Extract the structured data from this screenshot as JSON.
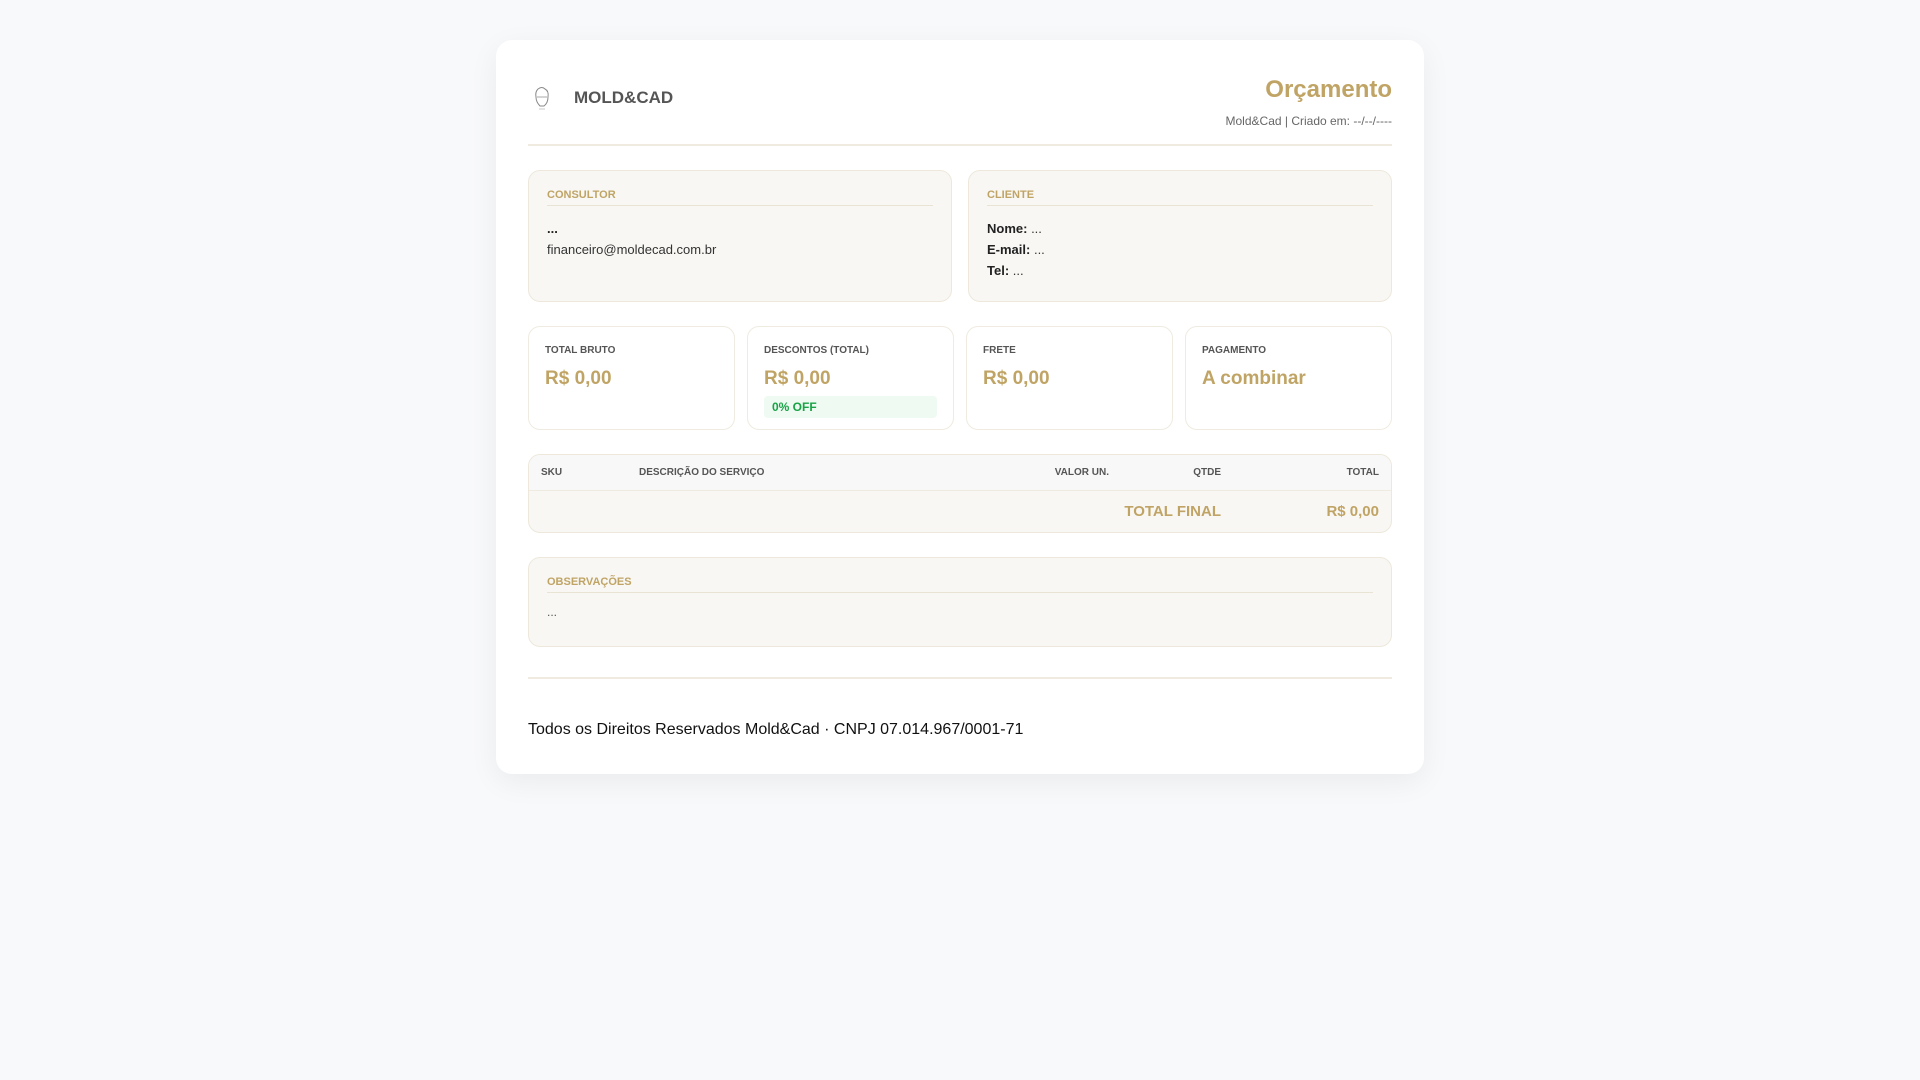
{
  "header": {
    "brand": "MOLD&CAD",
    "title": "Orçamento",
    "meta": "Mold&Cad | Criado em: --/--/----"
  },
  "consultor": {
    "heading": "CONSULTOR",
    "name": "...",
    "email": "financeiro@moldecad.com.br"
  },
  "cliente": {
    "heading": "CLIENTE",
    "nome_label": "Nome:",
    "nome": " ...",
    "email_label": "E-mail:",
    "email": " ...",
    "tel_label": "Tel:",
    "tel": " ..."
  },
  "stats": [
    {
      "label": "TOTAL BRUTO",
      "value": "R$ 0,00"
    },
    {
      "label": "DESCONTOS (TOTAL)",
      "value": "R$ 0,00",
      "badge": "0% OFF"
    },
    {
      "label": "FRETE",
      "value": "R$ 0,00"
    },
    {
      "label": "PAGAMENTO",
      "value": "A combinar"
    }
  ],
  "table": {
    "columns": [
      "SKU",
      "DESCRIÇÃO DO SERVIÇO",
      "VALOR UN.",
      "QTDE",
      "TOTAL"
    ],
    "rows": [],
    "total_label": "TOTAL FINAL",
    "total_value": "R$ 0,00"
  },
  "obs": {
    "heading": "OBSERVAÇÕES",
    "text": "..."
  },
  "footer": "Todos os Direitos Reservados Mold&Cad · CNPJ 07.014.967/0001-71"
}
